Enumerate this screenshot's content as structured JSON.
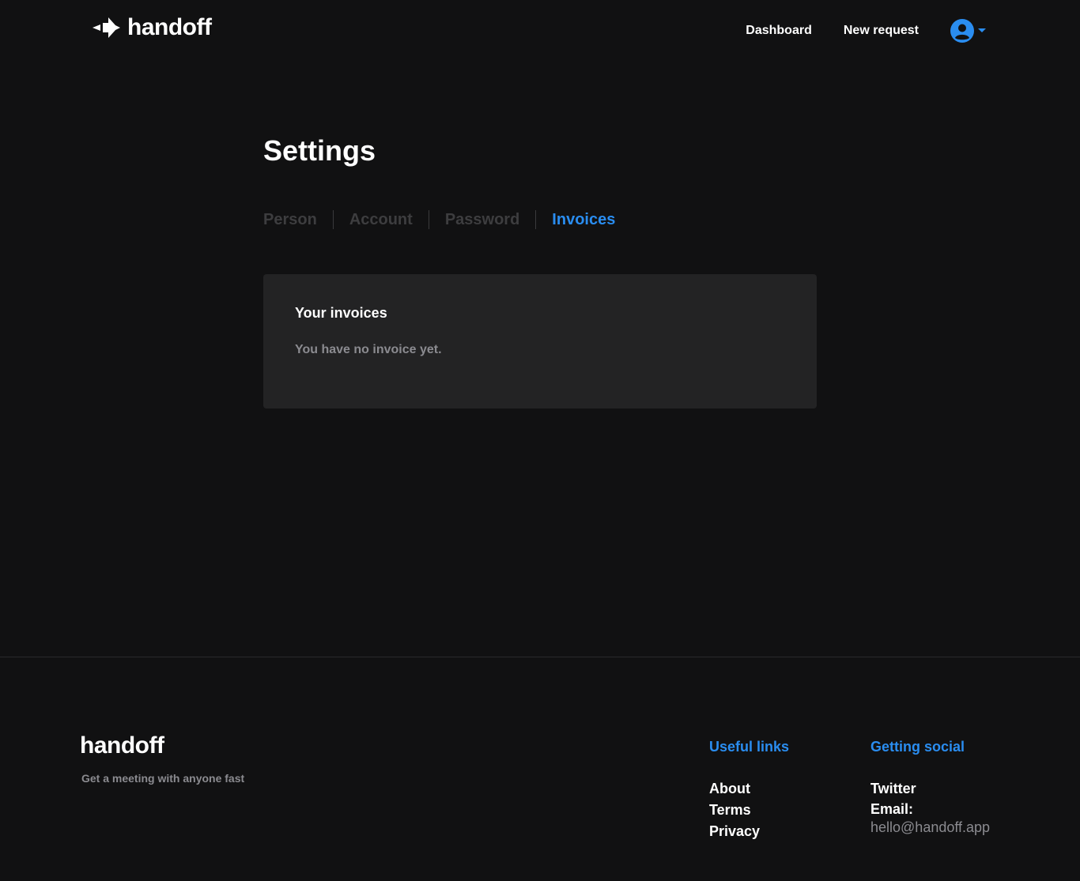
{
  "header": {
    "logo_text": "handoff",
    "nav": {
      "dashboard": "Dashboard",
      "new_request": "New request"
    },
    "avatar_icon": "user-circle-icon",
    "dropdown_icon": "caret-down-icon"
  },
  "main": {
    "title": "Settings",
    "tabs": [
      {
        "label": "Person",
        "active": false
      },
      {
        "label": "Account",
        "active": false
      },
      {
        "label": "Password",
        "active": false
      },
      {
        "label": "Invoices",
        "active": true
      }
    ],
    "card": {
      "title": "Your invoices",
      "text": "You have no invoice yet."
    }
  },
  "footer": {
    "logo_text": "handoff",
    "tagline": "Get a meeting with anyone fast",
    "useful_links": {
      "heading": "Useful links",
      "items": [
        "About",
        "Terms",
        "Privacy"
      ]
    },
    "social": {
      "heading": "Getting social",
      "twitter": "Twitter",
      "email_label": "Email:",
      "email": "hello@handoff.app"
    }
  },
  "colors": {
    "background": "#111112",
    "card": "#232324",
    "accent": "#2a8df0",
    "muted": "#8b8b90",
    "inactive_tab": "#3d3d3f"
  }
}
